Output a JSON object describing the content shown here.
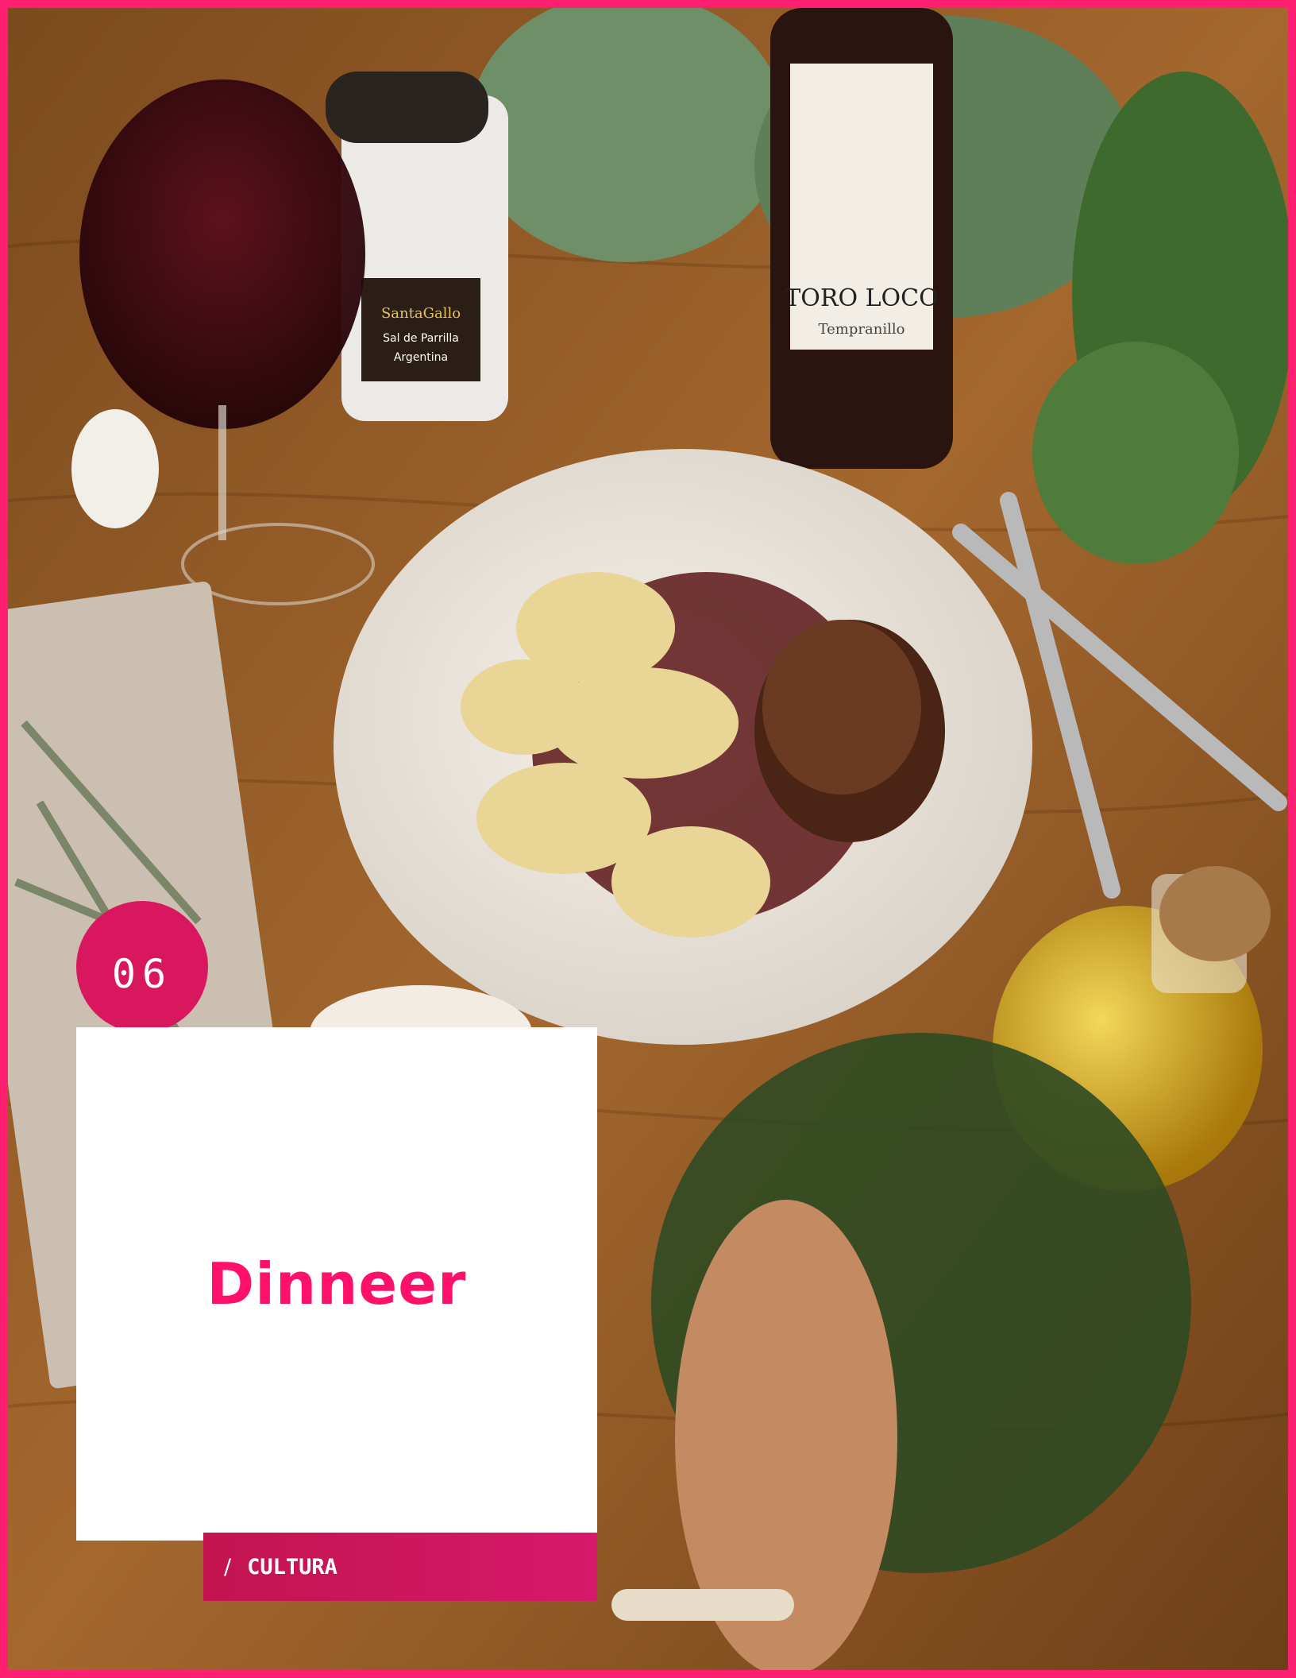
{
  "page": {
    "badge_number": "06",
    "title": "Dinneer",
    "section_separator": "/",
    "section_label": "CULTURA"
  },
  "photo": {
    "wine_label_brand": "TORO LOCO",
    "wine_label_varietal": "Tempranillo",
    "salt_jar_brand": "SantaGallo",
    "salt_jar_label": "Sal de Parrilla",
    "salt_jar_origin": "Argentina"
  },
  "colors": {
    "accent": "#ff1f70",
    "badge": "#d8175f",
    "bar": "#c2144f",
    "table_wood": "#8a5424"
  }
}
